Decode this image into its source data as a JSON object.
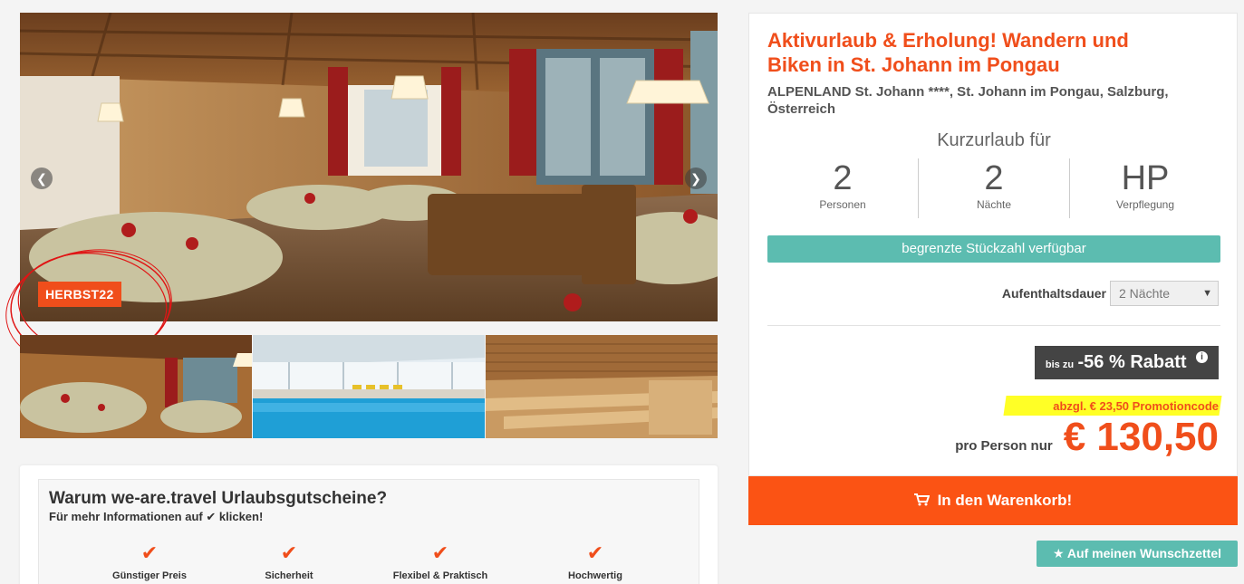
{
  "gallery": {
    "main_image_alt": "restaurant",
    "prev_icon": "chevron-left-icon",
    "next_icon": "chevron-right-icon",
    "promo_badge": "HERBST22",
    "thumbnails": [
      "restaurant",
      "indoor-pool",
      "sauna"
    ]
  },
  "why": {
    "title": "Warum we-are.travel Urlaubsgutscheine?",
    "sub_before": "Für mehr Informationen auf",
    "sub_check": "✔",
    "sub_after": "klicken!",
    "features": [
      {
        "check": "✔",
        "label": "Günstiger Preis"
      },
      {
        "check": "✔",
        "label": "Sicherheit"
      },
      {
        "check": "✔",
        "label": "Flexibel & Praktisch"
      },
      {
        "check": "✔",
        "label": "Hochwertig"
      }
    ]
  },
  "offer": {
    "title": "Aktivurlaub & Erholung! Wandern und Biken in St. Johann im Pongau",
    "subtitle": "ALPENLAND St. Johann ****, St. Johann im Pongau, Salzburg, Österreich",
    "kurz_title": "Kurzurlaub für",
    "stats": [
      {
        "value": "2",
        "label": "Personen"
      },
      {
        "value": "2",
        "label": "Nächte"
      },
      {
        "value": "HP",
        "label": "Verpflegung"
      }
    ],
    "availability": "begrenzte Stückzahl verfügbar",
    "duration_label": "Aufenthaltsdauer",
    "duration_value": "2 Nächte",
    "discount_small": "bis zu",
    "discount_big": "-56 % Rabatt",
    "discount_info": "i",
    "promo_text": "abzgl. € 23,50 Promotioncode",
    "price_label": "pro Person nur",
    "price": "€ 130,50"
  },
  "actions": {
    "cart_label": "In den Warenkorb!",
    "wish_label": "Auf meinen Wunschzettel"
  },
  "colors": {
    "accent": "#f04e1b",
    "teal": "#5cbcb0",
    "cart": "#fb5314"
  }
}
